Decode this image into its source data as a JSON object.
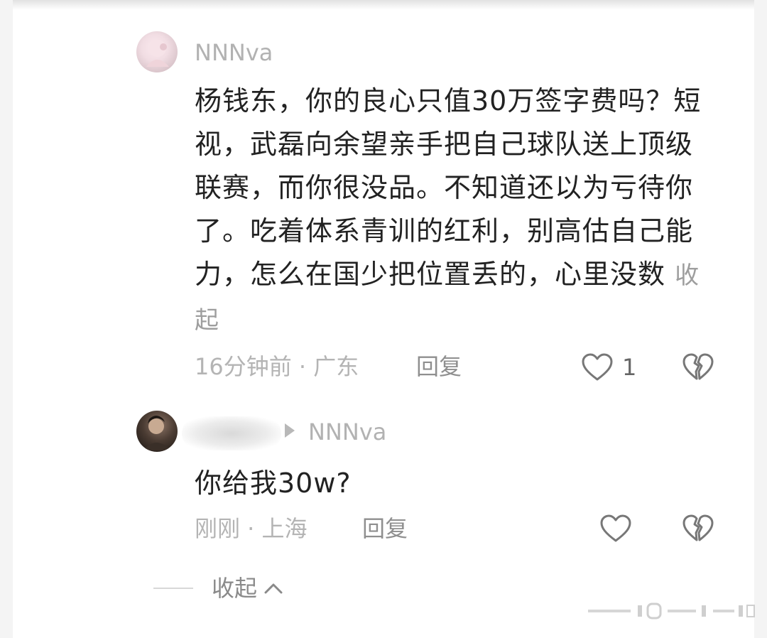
{
  "comments": [
    {
      "username": "NNNva",
      "text": "杨钱东，你的良心只值30万签字费吗？短视，武磊向余望亲手把自己球队送上顶级联赛，而你很没品。不知道还以为亏待你了。吃着体系青训的红利，别高估自己能力，怎么在国少把位置丢的，心里没数",
      "collapse_label": "收起",
      "meta": "16分钟前 · 广东",
      "reply_label": "回复",
      "likes": "1"
    },
    {
      "reply_to": "NNNva",
      "text": "你给我30w?",
      "meta": "刚刚 · 上海",
      "reply_label": "回复"
    }
  ],
  "thread": {
    "collapse_label": "收起"
  },
  "icons": {
    "like": "heart-outline-icon",
    "dislike": "broken-heart-icon",
    "collapse": "chevron-up-icon",
    "play": "play-triangle-icon"
  }
}
